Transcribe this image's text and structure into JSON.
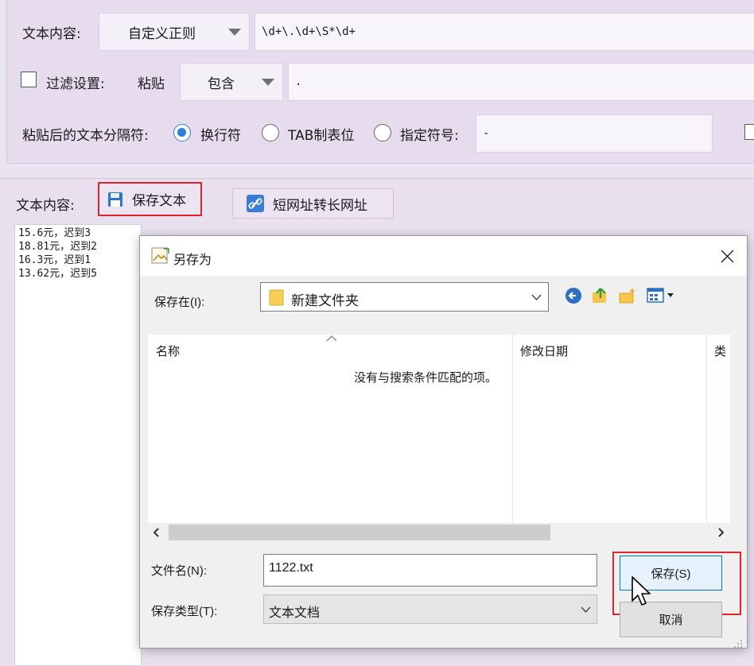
{
  "top": {
    "text_content_label": "文本内容:",
    "pattern_combo": "自定义正则",
    "regex_value": "\\d+\\.\\d+\\S*\\d+",
    "filter_label": "过滤设置:",
    "paste_label": "粘贴",
    "contain_combo": "包含",
    "filter_value": ".",
    "separator_label": "粘贴后的文本分隔符:",
    "opt_newline": "换行符",
    "opt_tab": "TAB制表位",
    "opt_custom": "指定符号:",
    "custom_symbol": "-"
  },
  "lower": {
    "text_content_label": "文本内容:",
    "save_text_button": "保存文本",
    "short_url_button": "短网址转长网址",
    "lines": [
      "15.6元，迟到3",
      "18.81元，迟到2",
      "16.3元，迟到1",
      "13.62元，迟到5"
    ]
  },
  "dialog": {
    "title": "另存为",
    "save_in_label": "保存在(I):",
    "save_in_value": "新建文件夹",
    "col_name": "名称",
    "col_modified": "修改日期",
    "col_type": "类",
    "empty_message": "没有与搜索条件匹配的项。",
    "filename_label": "文件名(N):",
    "filename_value": "1122.txt",
    "filetype_label": "保存类型(T):",
    "filetype_value": "文本文档",
    "save_button": "保存(S)",
    "cancel_button": "取消"
  },
  "colors": {
    "accent": "#2f7fd4",
    "highlight": "#e0262b",
    "background": "#eae3f0"
  }
}
